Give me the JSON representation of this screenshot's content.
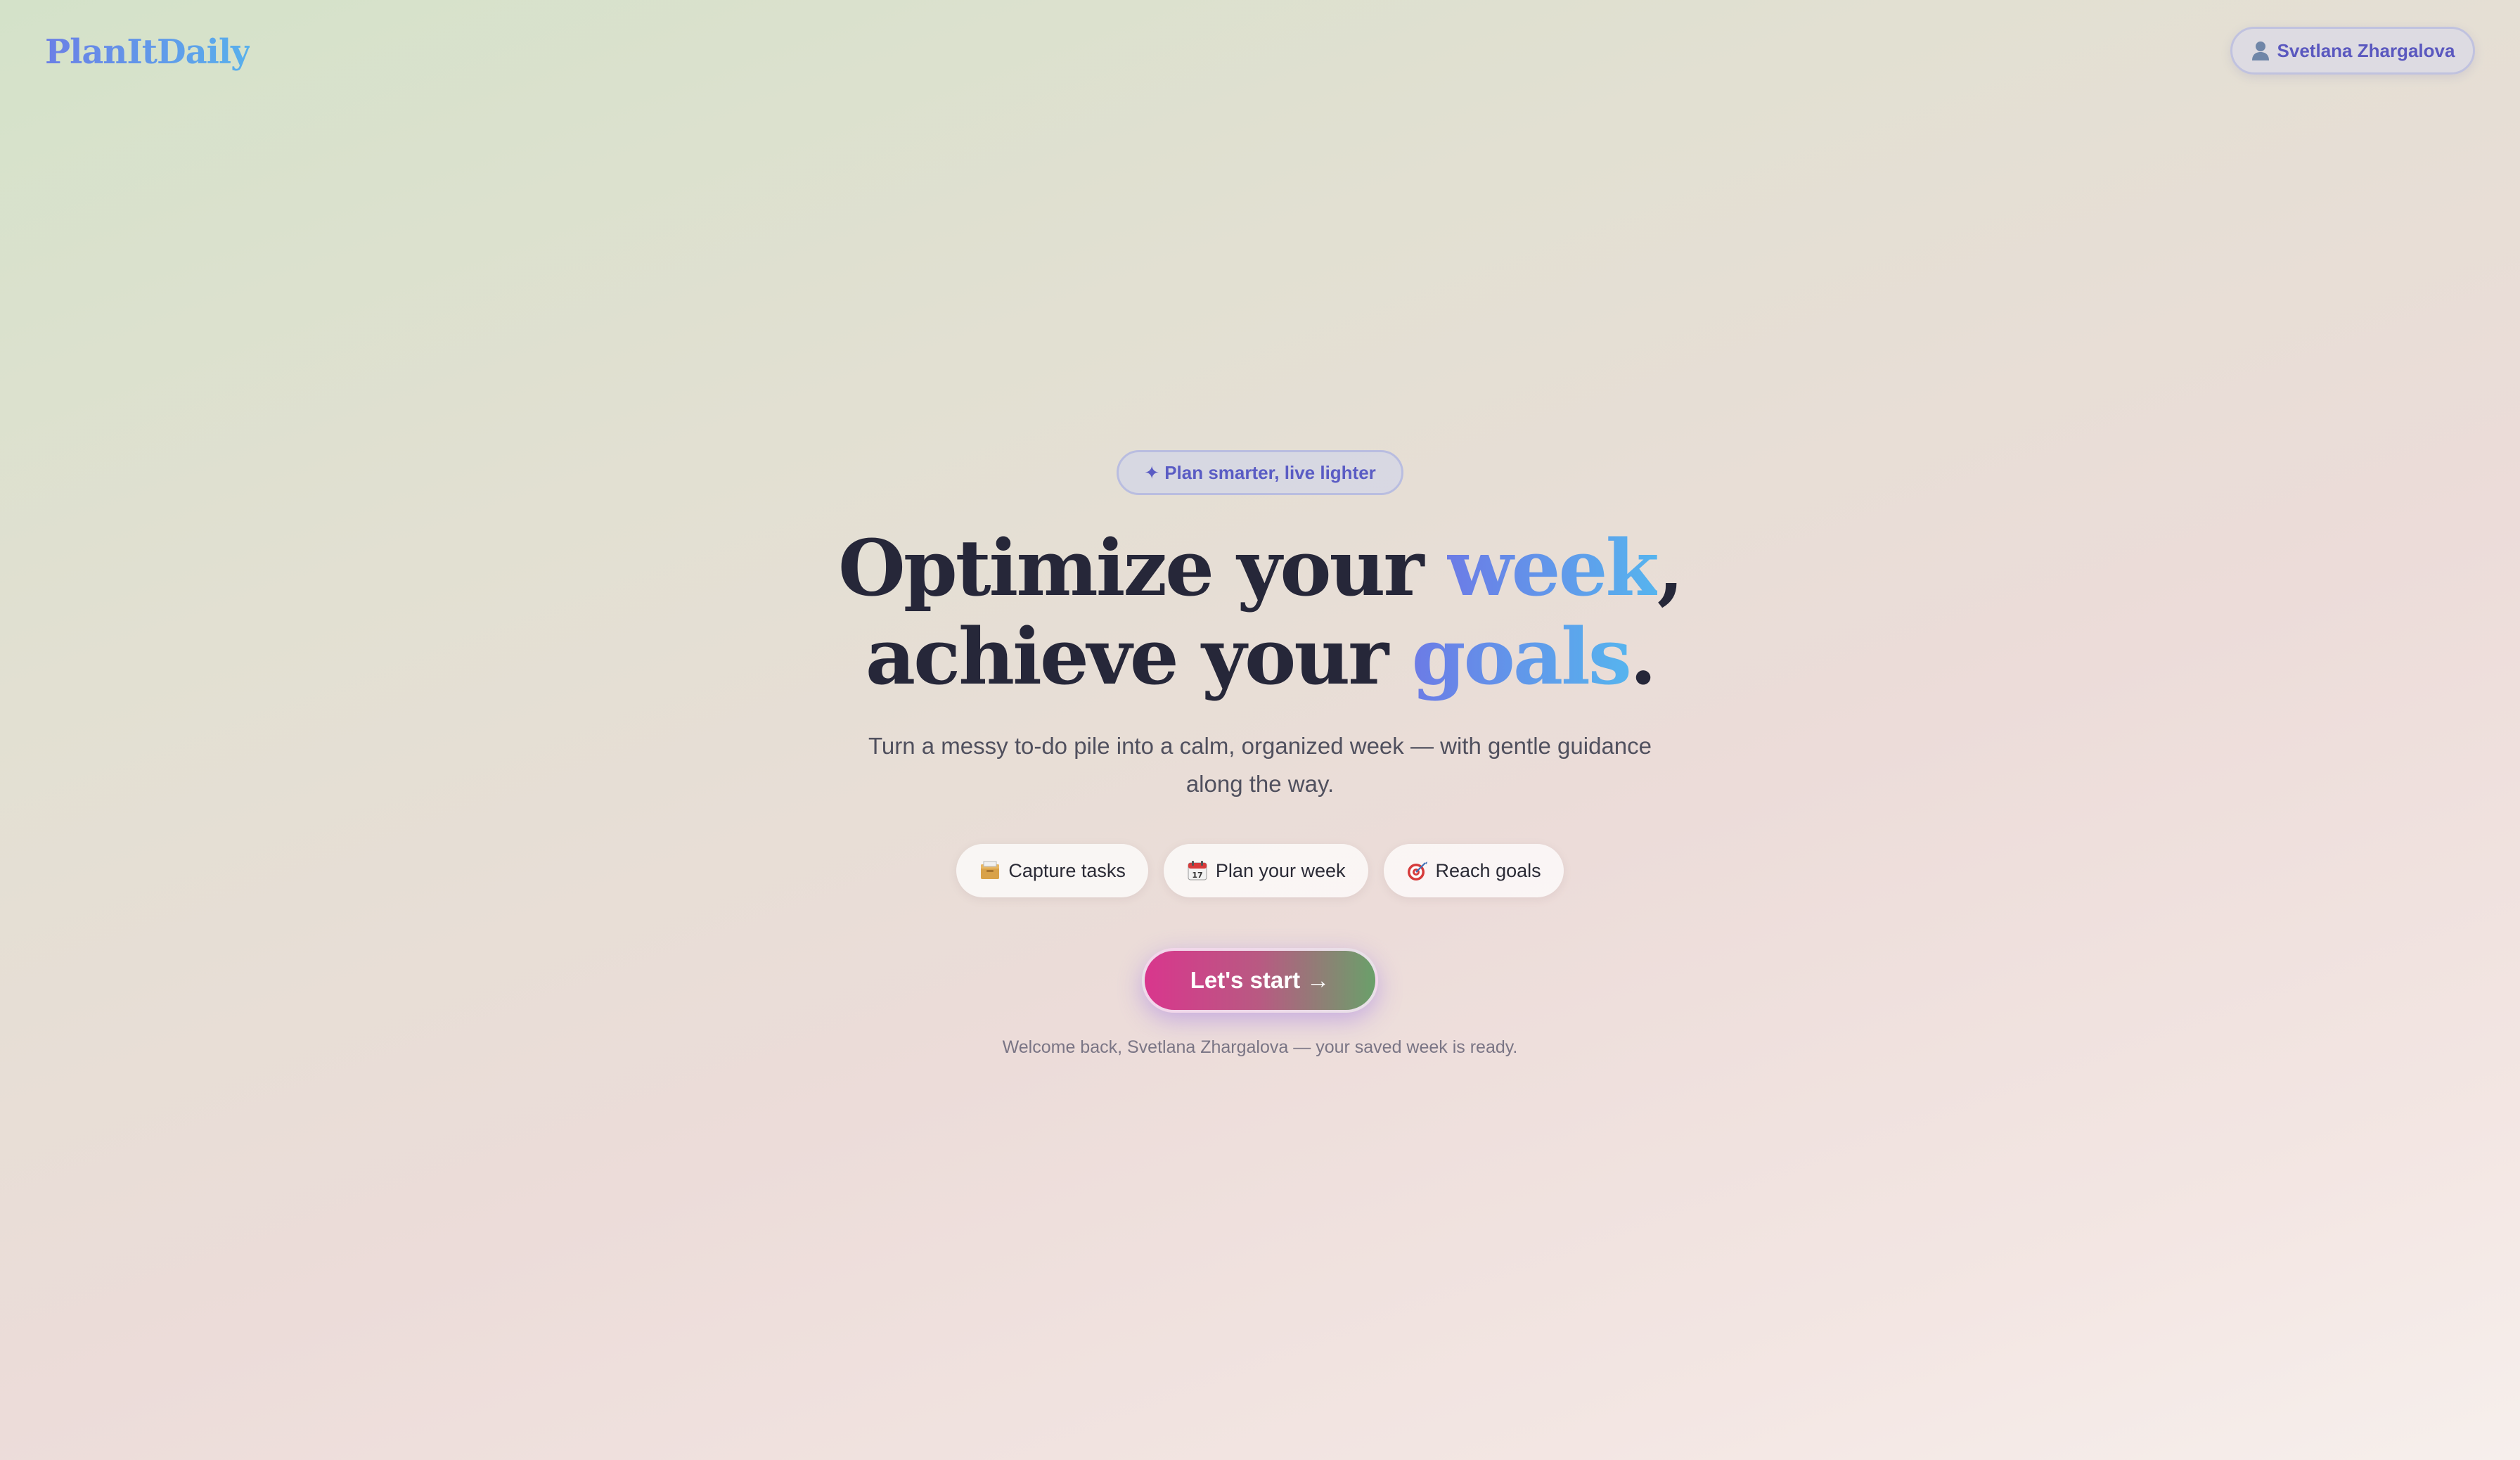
{
  "header": {
    "logo": "PlanItDaily",
    "user_name": "Svetlana Zhargalova",
    "user_icon": "user-icon"
  },
  "hero": {
    "tagline": "✦ Plan smarter, live lighter",
    "headline_line1_prefix": "Optimize your ",
    "headline_line1_accent": "week",
    "headline_line1_suffix": ",",
    "headline_line2_prefix": "achieve your ",
    "headline_line2_accent": "goals",
    "headline_line2_suffix": ".",
    "subtitle": "Turn a messy to-do pile into a calm, organized week — with gentle guidance along the way.",
    "chips": [
      {
        "icon": "card-box-icon",
        "label": "Capture tasks"
      },
      {
        "icon": "calendar-icon",
        "label": "Plan your week"
      },
      {
        "icon": "target-icon",
        "label": "Reach goals"
      }
    ],
    "cta_label": "Let's start →",
    "welcome_message": "Welcome back, Svetlana Zhargalova — your saved week is ready."
  },
  "colors": {
    "accent_gradient_start": "#6c7be6",
    "accent_gradient_end": "#56b4ee",
    "headline_text": "#262739",
    "cta_gradient_start": "#d9368d",
    "cta_gradient_end": "#6aa06a",
    "tagline_text": "#5a5cc4"
  }
}
